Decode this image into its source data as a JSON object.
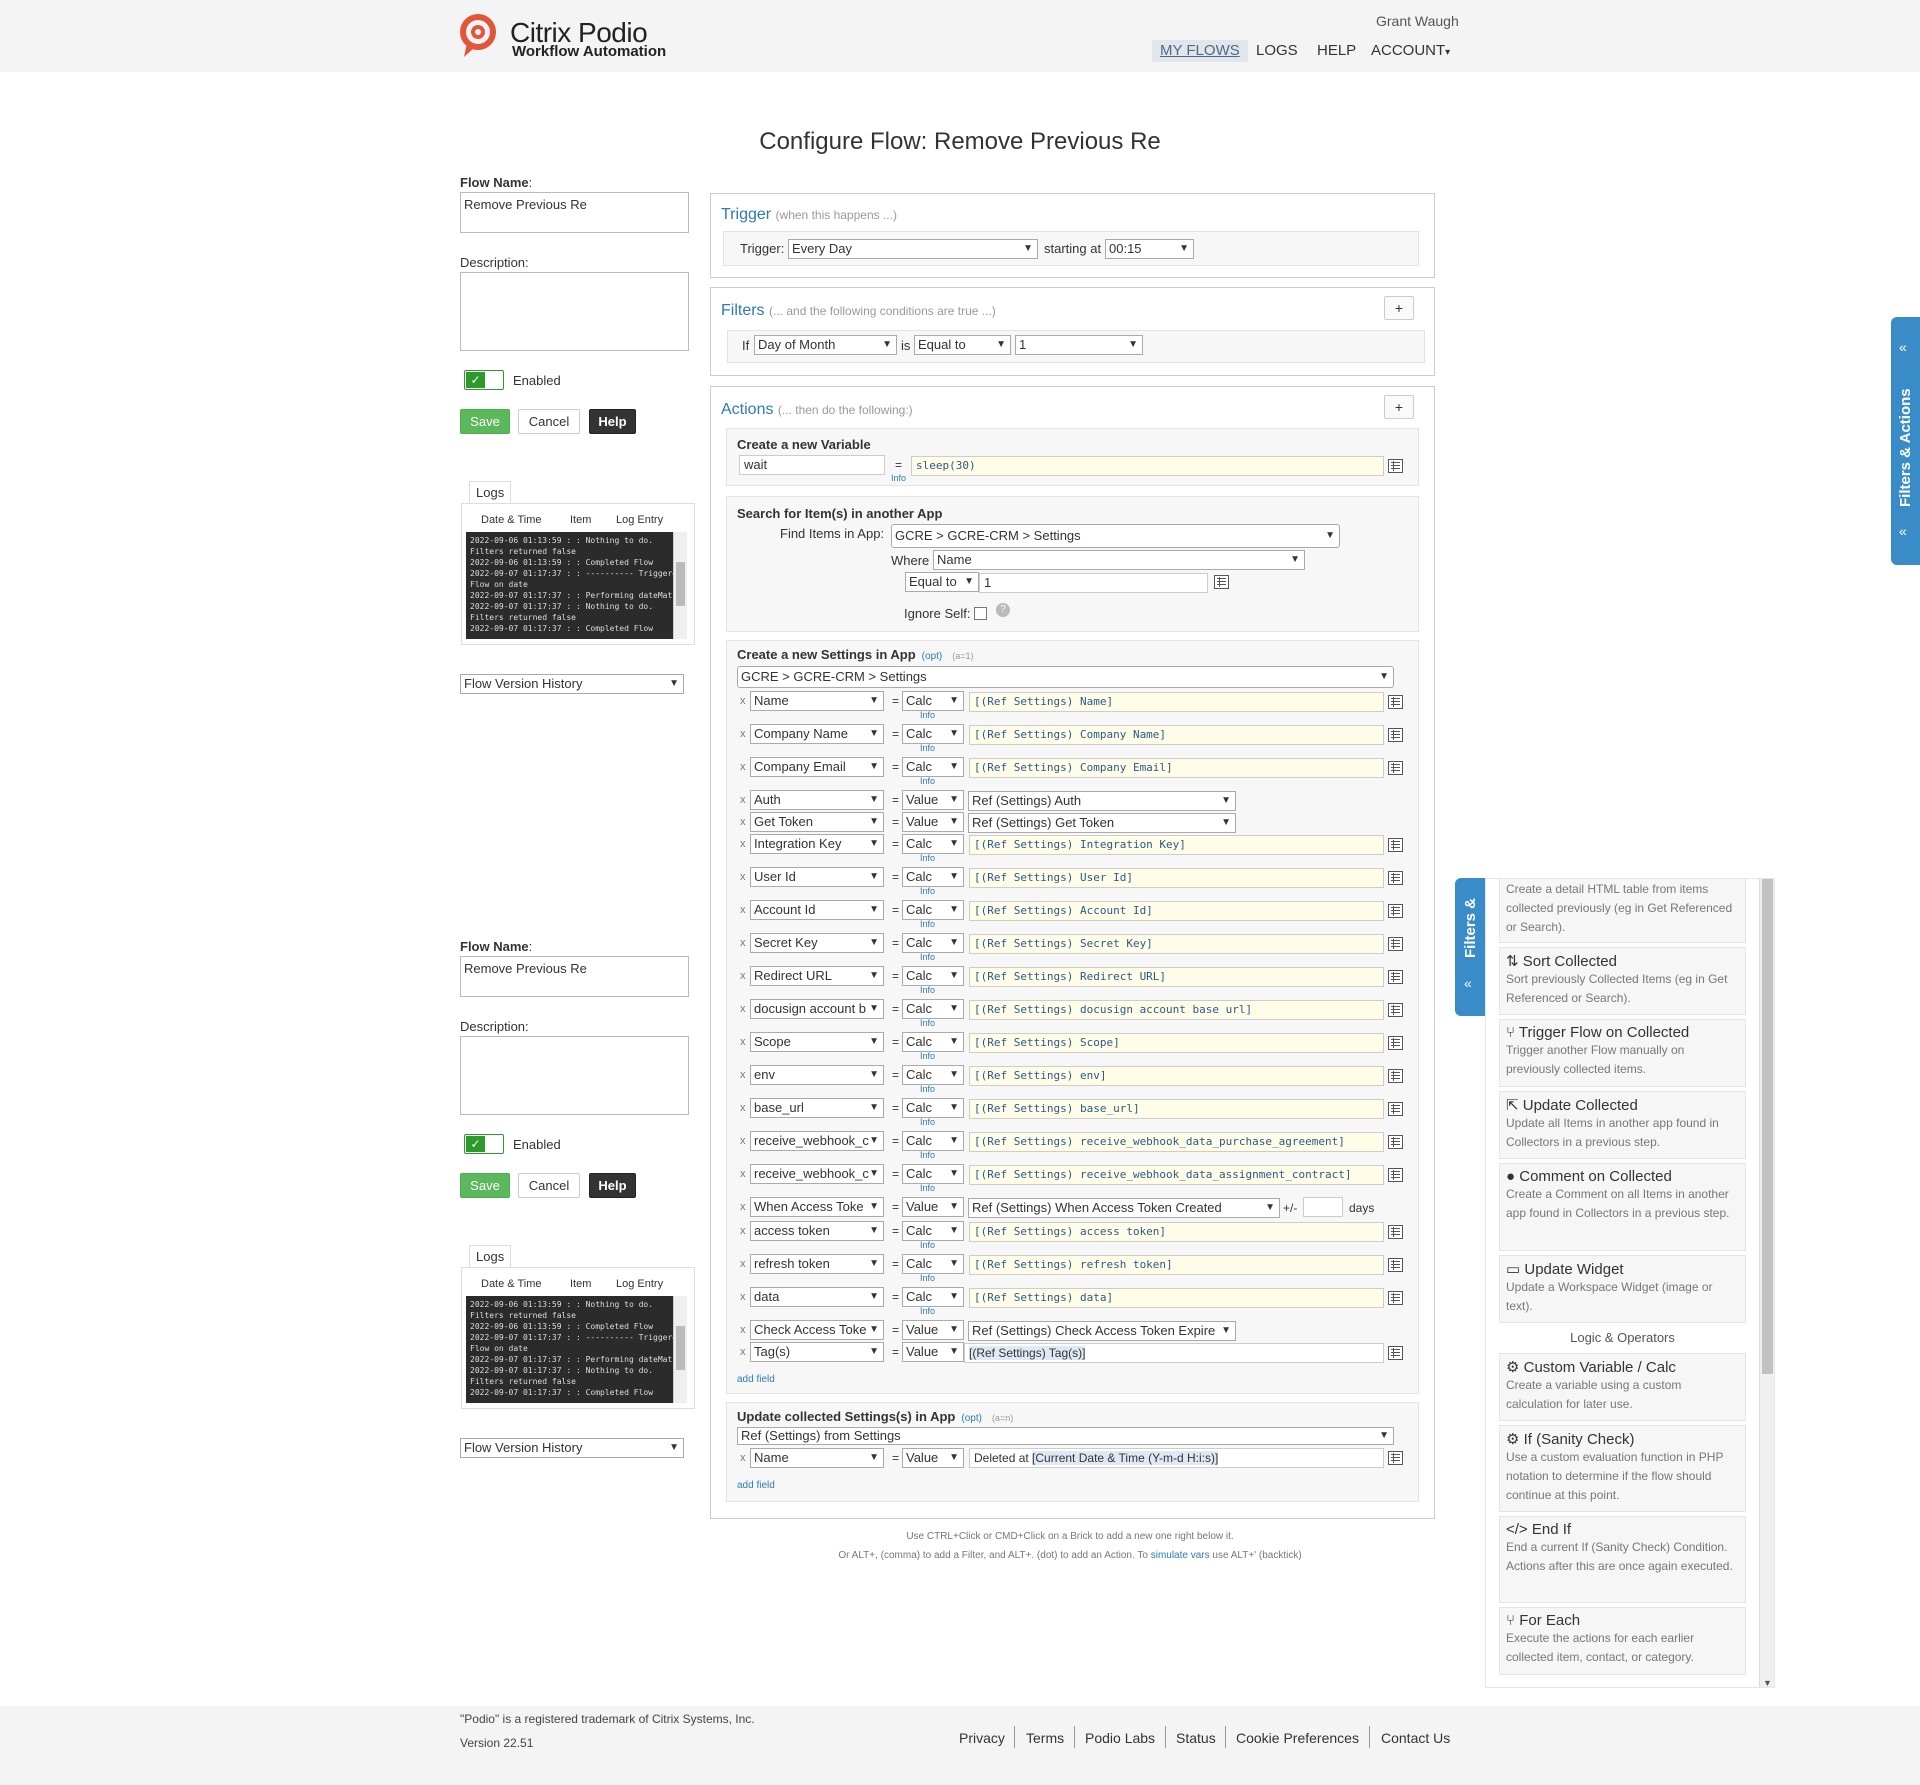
{
  "header": {
    "brand_name": "Citrix Podio",
    "brand_sub": "Workflow Automation",
    "user": "Grant Waugh",
    "nav": {
      "my_flows": "MY FLOWS",
      "logs": "LOGS",
      "help": "HELP",
      "account": "ACCOUNT"
    }
  },
  "page_title": "Configure Flow: Remove Previous Re",
  "left": {
    "flow_name_label": "Flow Name",
    "flow_name_value": "Remove Previous Re",
    "description_label": "Description:",
    "enabled_label": "Enabled",
    "save": "Save",
    "cancel": "Cancel",
    "help": "Help",
    "logs_tab": "Logs",
    "log_headers": {
      "date": "Date & Time",
      "item": "Item",
      "entry": "Log Entry"
    },
    "log_text": "2022-09-06 01:13:59 : : Nothing to do.\nFilters returned false\n2022-09-06 01:13:59 : : Completed Flow\n2022-09-07 01:17:37 : : ---------- Triggered\nFlow on date\n2022-09-07 01:17:37 : : Performing dateMatch\n2022-09-07 01:17:37 : : Nothing to do.\nFilters returned false\n2022-09-07 01:17:37 : : Completed Flow",
    "version_history": "Flow Version History"
  },
  "trigger": {
    "title": "Trigger",
    "subtitle": "(when this happens ...)",
    "label": "Trigger:",
    "value": "Every Day",
    "starting_label": "starting at",
    "time": "00:15"
  },
  "filters": {
    "title": "Filters",
    "subtitle": "(... and the following conditions are true ...)",
    "if": "If",
    "field": "Day of Month",
    "is": "is",
    "op": "Equal to",
    "value": "1"
  },
  "actions": {
    "title": "Actions",
    "subtitle": "(... then do the following:)",
    "var_block": {
      "title": "Create a new Variable",
      "name": "wait",
      "expr": "sleep(30)",
      "info": "Info"
    },
    "search_block": {
      "title": "Search for Item(s) in another App",
      "find_label": "Find Items in App:",
      "app": "GCRE > GCRE-CRM > Settings",
      "where_label": "Where",
      "where_field": "Name",
      "op": "Equal to",
      "value": "1",
      "ignore_self": "Ignore Self:"
    },
    "create_block": {
      "title": "Create a new Settings in App",
      "opt": "(opt)",
      "tiny": "(a=1)",
      "app": "GCRE > GCRE-CRM > Settings",
      "rows": [
        {
          "field": "Name",
          "mode": "Calc",
          "value": "[(Ref Settings) Name]"
        },
        {
          "field": "Company Name",
          "mode": "Calc",
          "value": "[(Ref Settings) Company Name]"
        },
        {
          "field": "Company Email",
          "mode": "Calc",
          "value": "[(Ref Settings) Company Email]"
        },
        {
          "field": "Auth",
          "mode": "Value",
          "value": "Ref (Settings) Auth"
        },
        {
          "field": "Get Token",
          "mode": "Value",
          "value": "Ref (Settings) Get Token"
        },
        {
          "field": "Integration Key",
          "mode": "Calc",
          "value": "[(Ref Settings) Integration Key]"
        },
        {
          "field": "User Id",
          "mode": "Calc",
          "value": "[(Ref Settings) User Id]"
        },
        {
          "field": "Account Id",
          "mode": "Calc",
          "value": "[(Ref Settings) Account Id]"
        },
        {
          "field": "Secret Key",
          "mode": "Calc",
          "value": "[(Ref Settings) Secret Key]"
        },
        {
          "field": "Redirect URL",
          "mode": "Calc",
          "value": "[(Ref Settings) Redirect URL]"
        },
        {
          "field": "docusign account b",
          "mode": "Calc",
          "value": "[(Ref Settings) docusign account base url]"
        },
        {
          "field": "Scope",
          "mode": "Calc",
          "value": "[(Ref Settings) Scope]"
        },
        {
          "field": "env",
          "mode": "Calc",
          "value": "[(Ref Settings) env]"
        },
        {
          "field": "base_url",
          "mode": "Calc",
          "value": "[(Ref Settings) base_url]"
        },
        {
          "field": "receive_webhook_c",
          "mode": "Calc",
          "value": "[(Ref Settings) receive_webhook_data_purchase_agreement]"
        },
        {
          "field": "receive_webhook_c",
          "mode": "Calc",
          "value": "[(Ref Settings) receive_webhook_data_assignment_contract]"
        },
        {
          "field": "When Access Toke",
          "mode": "Value",
          "value": "Ref (Settings) When Access Token Created",
          "extra": "+/-",
          "days": "days"
        },
        {
          "field": "access token",
          "mode": "Calc",
          "value": "[(Ref Settings) access token]"
        },
        {
          "field": "refresh token",
          "mode": "Calc",
          "value": "[(Ref Settings) refresh token]"
        },
        {
          "field": "data",
          "mode": "Calc",
          "value": "[(Ref Settings) data]"
        },
        {
          "field": "Check Access Toke",
          "mode": "Value",
          "value": "Ref (Settings) Check Access Token Expire"
        },
        {
          "field": "Tag(s)",
          "mode": "Value",
          "value": "[(Ref Settings) Tag(s)]"
        }
      ],
      "add_field": "add field",
      "info": "Info"
    },
    "update_block": {
      "title": "Update collected Settings(s) in App",
      "opt": "(opt)",
      "tiny": "(a=n)",
      "app": "Ref (Settings) from Settings",
      "field": "Name",
      "mode": "Value",
      "value_prefix": "Deleted at ",
      "value_token": "[Current Date & Time (Y-m-d H:i:s)]",
      "add_field": "add field"
    }
  },
  "hint": {
    "line1": "Use CTRL+Click or CMD+Click on a Brick to add a new one right below it.",
    "line2_pre": "Or ALT+, (comma) to add a Filter, and ALT+. (dot) to add an Action. To",
    "line2_link": "simulate vars",
    "line2_post": "use ALT+' (backtick)"
  },
  "side": {
    "tab_label": "Filters & Actions",
    "tab_label_short": "Filters &",
    "cards": [
      {
        "title": "",
        "desc": "Create a detail HTML table from items collected previously (eg in Get Referenced or Search).",
        "icon": ""
      },
      {
        "title": "Sort Collected",
        "desc": "Sort previously Collected Items (eg in Get Referenced or Search).",
        "icon": "sort-icon"
      },
      {
        "title": "Trigger Flow on Collected",
        "desc": "Trigger another Flow manually on previously collected items.",
        "icon": "flow-icon"
      },
      {
        "title": "Update Collected",
        "desc": "Update all Items in another app found in Collectors in a previous step.",
        "icon": "external-link-icon"
      },
      {
        "title": "Comment on Collected",
        "desc": "Create a Comment on all Items in another app found in Collectors in a previous step.",
        "icon": "comment-icon"
      },
      {
        "title": "Update Widget",
        "desc": "Update a Workspace Widget (image or text).",
        "icon": "folder-icon"
      },
      {
        "title": "Custom Variable / Calc",
        "desc": "Create a variable using a custom calculation for later use.",
        "icon": "cogs-icon"
      },
      {
        "title": "If (Sanity Check)",
        "desc": "Use a custom evaluation function in PHP notation to determine if the flow should continue at this point.",
        "icon": "cogs-icon"
      },
      {
        "title": "End If",
        "desc": "End a current If (Sanity Check) Condition. Actions after this are once again executed.",
        "icon": "code-icon"
      },
      {
        "title": "For Each",
        "desc": "Execute the actions for each earlier collected item, contact, or category.",
        "icon": "flow-icon"
      }
    ],
    "section_logic": "Logic & Operators"
  },
  "footer": {
    "trademark": "\"Podio\" is a registered trademark of Citrix Systems, Inc.",
    "version": "Version 22.51",
    "links": [
      "Privacy",
      "Terms",
      "Podio Labs",
      "Status",
      "Cookie Preferences",
      "Contact Us"
    ]
  },
  "colors": {
    "accent": "#2f7ab8",
    "save": "#5cb85c",
    "brand": "#e2553b",
    "sidetab": "#3a8cc9"
  }
}
